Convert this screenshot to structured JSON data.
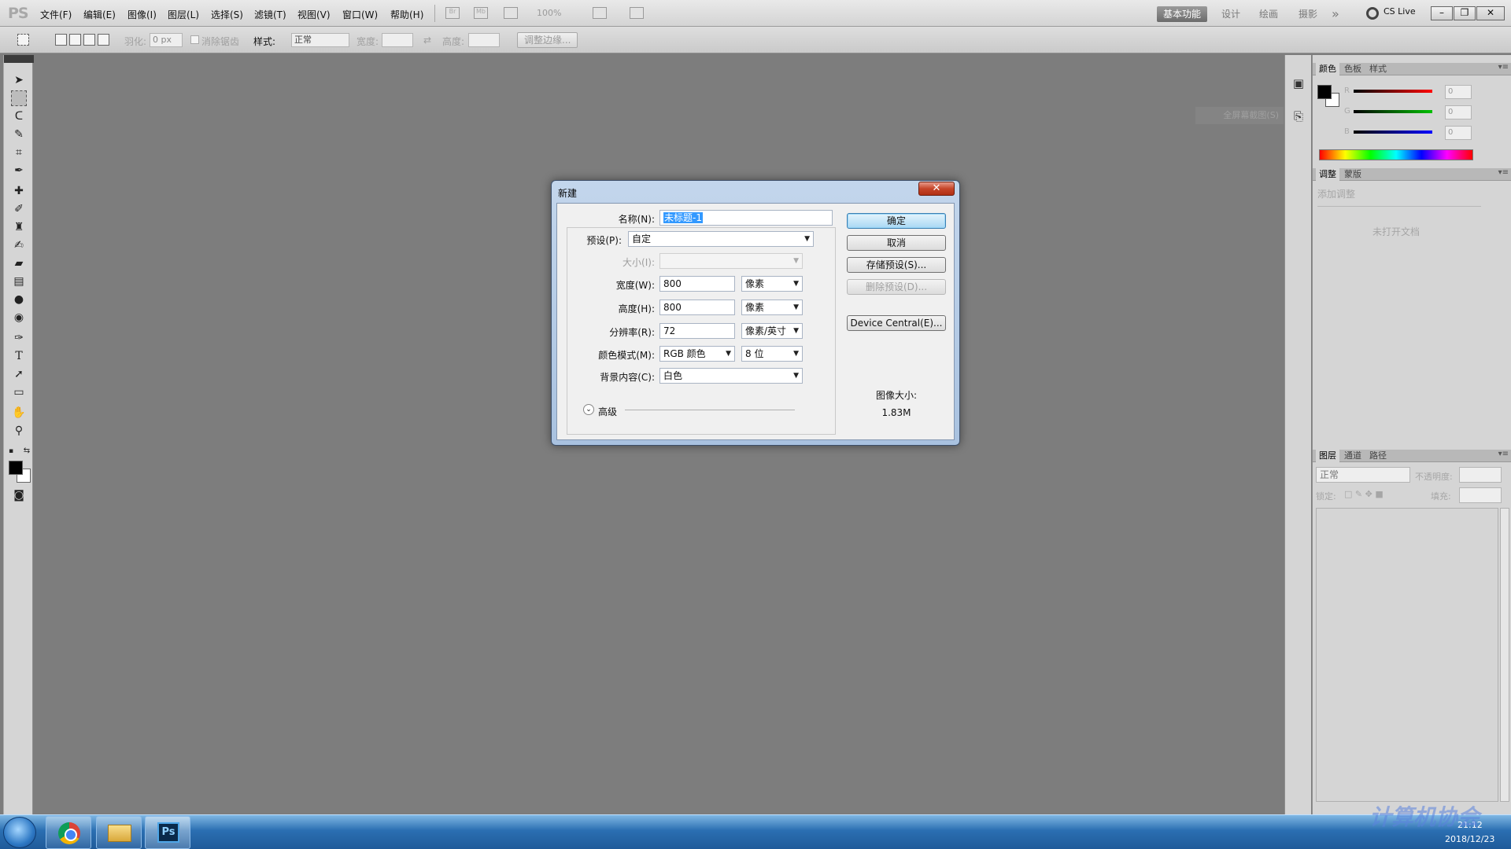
{
  "menubar": {
    "logo": "PS",
    "items": [
      "文件(F)",
      "编辑(E)",
      "图像(I)",
      "图层(L)",
      "选择(S)",
      "滤镜(T)",
      "视图(V)",
      "窗口(W)",
      "帮助(H)"
    ],
    "br_label": "Br",
    "mb_label": "Mb",
    "zoom": "100%",
    "workspaces": [
      "基本功能",
      "设计",
      "绘画",
      "摄影"
    ],
    "more": "»",
    "cs_live": "CS Live"
  },
  "options": {
    "feather_label": "羽化:",
    "feather_value": "0 px",
    "antialias_label": "消除锯齿",
    "style_label": "样式:",
    "style_value": "正常",
    "width_label": "宽度:",
    "height_label": "高度:",
    "refine_edge": "调整边缘..."
  },
  "canvas": {
    "collapsed_panel": "全屏幕截图(S)"
  },
  "panels": {
    "color_tabs": [
      "颜色",
      "色板",
      "样式"
    ],
    "color": {
      "r_label": "R",
      "g_label": "G",
      "b_label": "B",
      "r": "0",
      "g": "0",
      "b": "0",
      "accent_r": "#ff0000",
      "accent_g": "#00c000",
      "accent_b": "#0000ff"
    },
    "adjust_tabs": [
      "调整",
      "蒙版"
    ],
    "adjust_title": "添加调整",
    "adjust_empty": "未打开文档",
    "layers_tabs": [
      "图层",
      "通道",
      "路径"
    ],
    "blend_mode": "正常",
    "opacity_label": "不透明度:",
    "lock_label": "锁定:",
    "fill_label": "填充:"
  },
  "dialog": {
    "title": "新建",
    "close": "✕",
    "name_label": "名称(N):",
    "name_value": "未标题-1",
    "preset_label": "预设(P):",
    "preset_value": "自定",
    "size_label": "大小(I):",
    "width_label": "宽度(W):",
    "width_value": "800",
    "width_unit": "像素",
    "height_label": "高度(H):",
    "height_value": "800",
    "height_unit": "像素",
    "res_label": "分辨率(R):",
    "res_value": "72",
    "res_unit": "像素/英寸",
    "mode_label": "颜色模式(M):",
    "mode_value": "RGB 颜色",
    "depth_value": "8 位",
    "bg_label": "背景内容(C):",
    "bg_value": "白色",
    "advanced": "高级",
    "ok": "确定",
    "cancel": "取消",
    "save_preset": "存储预设(S)...",
    "delete_preset": "删除预设(D)...",
    "device_central": "Device Central(E)...",
    "image_size_label": "图像大小:",
    "image_size_value": "1.83M"
  },
  "taskbar": {
    "ps_label": "Ps",
    "time": "21:12",
    "date": "2018/12/23",
    "watermark": "计算机协会"
  }
}
